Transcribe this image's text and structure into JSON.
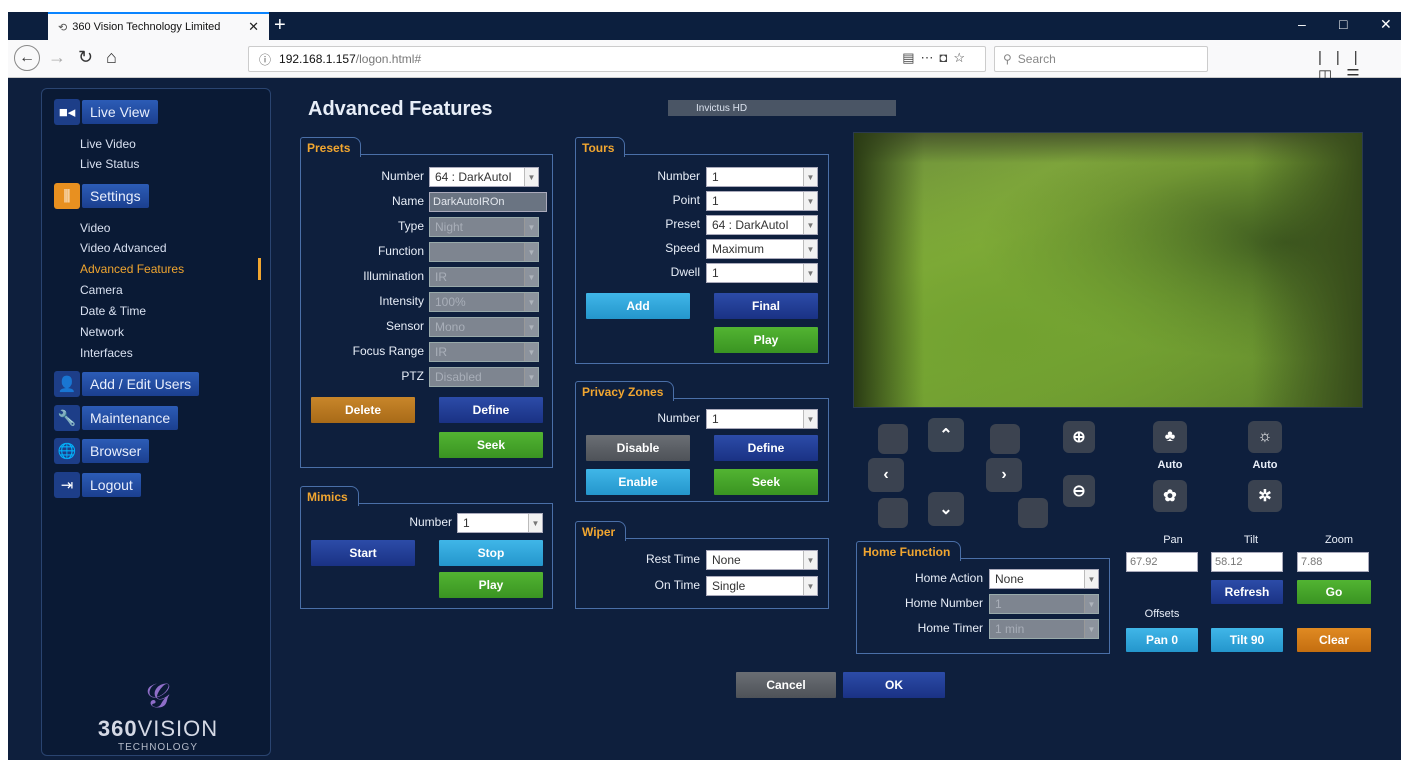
{
  "browser": {
    "tab_title": "360 Vision Technology Limited",
    "tab_close": "✕",
    "new_tab": "+",
    "url_host": "192.168.1.157",
    "url_path": "/logon.html#",
    "search_placeholder": "Search",
    "minimize": "–",
    "maximize": "□",
    "close": "✕"
  },
  "sidebar": {
    "live_view": "Live View",
    "live_video": "Live Video",
    "live_status": "Live Status",
    "settings": "Settings",
    "items": [
      "Video",
      "Video Advanced",
      "Advanced Features",
      "Camera",
      "Date & Time",
      "Network",
      "Interfaces"
    ],
    "add_edit_users": "Add / Edit Users",
    "maintenance": "Maintenance",
    "browser": "Browser",
    "logout": "Logout",
    "logo_brand_a": "360",
    "logo_brand_b": "VISION",
    "logo_sub": "TECHNOLOGY"
  },
  "main": {
    "title": "Advanced Features",
    "camera_name": "Invictus HD"
  },
  "presets": {
    "tab": "Presets",
    "number_label": "Number",
    "number_value": "64 : DarkAutoI",
    "name_label": "Name",
    "name_value": "DarkAutoIROn",
    "type_label": "Type",
    "type_value": "Night",
    "function_label": "Function",
    "function_value": "",
    "illumination_label": "Illumination",
    "illumination_value": "IR",
    "intensity_label": "Intensity",
    "intensity_value": "100%",
    "sensor_label": "Sensor",
    "sensor_value": "Mono",
    "focus_range_label": "Focus Range",
    "focus_range_value": "IR",
    "ptz_label": "PTZ",
    "ptz_value": "Disabled",
    "delete": "Delete",
    "define": "Define",
    "seek": "Seek"
  },
  "mimics": {
    "tab": "Mimics",
    "number_label": "Number",
    "number_value": "1",
    "start": "Start",
    "stop": "Stop",
    "play": "Play"
  },
  "tours": {
    "tab": "Tours",
    "number_label": "Number",
    "number_value": "1",
    "point_label": "Point",
    "point_value": "1",
    "preset_label": "Preset",
    "preset_value": "64 : DarkAutoI",
    "speed_label": "Speed",
    "speed_value": "Maximum",
    "dwell_label": "Dwell",
    "dwell_value": "1",
    "add": "Add",
    "final": "Final",
    "play": "Play"
  },
  "privacy": {
    "tab": "Privacy Zones",
    "number_label": "Number",
    "number_value": "1",
    "disable": "Disable",
    "define": "Define",
    "enable": "Enable",
    "seek": "Seek"
  },
  "wiper": {
    "tab": "Wiper",
    "rest_label": "Rest Time",
    "rest_value": "None",
    "on_label": "On Time",
    "on_value": "Single"
  },
  "home": {
    "tab": "Home Function",
    "action_label": "Home Action",
    "action_value": "None",
    "number_label": "Home Number",
    "number_value": "1",
    "timer_label": "Home Timer",
    "timer_value": "1 min"
  },
  "ptz": {
    "auto_focus": "Auto",
    "auto_iris": "Auto",
    "pan_label": "Pan",
    "tilt_label": "Tilt",
    "zoom_label": "Zoom",
    "pan_value": "67.92",
    "tilt_value": "58.12",
    "zoom_value": "7.88",
    "refresh": "Refresh",
    "go": "Go",
    "offsets_label": "Offsets",
    "pan0": "Pan 0",
    "tilt90": "Tilt 90",
    "clear": "Clear"
  },
  "footer": {
    "cancel": "Cancel",
    "ok": "OK"
  },
  "colors": {
    "page_bg": "#0e1f3d",
    "accent_orange": "#f1a630",
    "button_navy": "#1a3284",
    "button_green": "#3a9422",
    "button_teal": "#2496cc"
  }
}
